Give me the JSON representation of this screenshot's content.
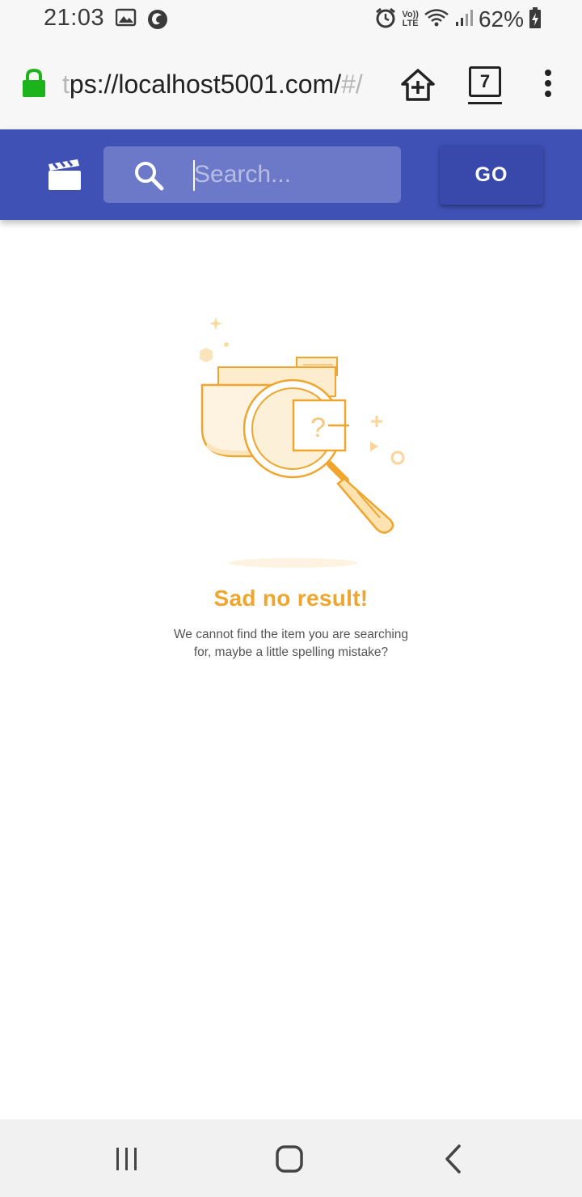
{
  "status_bar": {
    "time": "21:03",
    "battery": "62%",
    "volte_line1": "Vo))",
    "volte_line2": "LTE",
    "icons": [
      "image-icon",
      "firefox-icon",
      "alarm-icon",
      "volte-icon",
      "wifi-icon",
      "signal-icon",
      "battery-charging-icon"
    ]
  },
  "browser": {
    "url_faded": "t",
    "url_main": "ps://localhost5001.com/",
    "url_tail": "#/",
    "tab_count": "7",
    "icons": [
      "lock-icon",
      "home-plus-icon",
      "tabs-icon",
      "more-vert-icon"
    ]
  },
  "header": {
    "search_placeholder": "Search...",
    "search_value": "",
    "go_label": "GO",
    "accent_color": "#3f51b5",
    "search_box_color": "#6b79c8",
    "icons": [
      "clapperboard-icon",
      "search-icon"
    ]
  },
  "empty_state": {
    "title": "Sad no result!",
    "description_line1": "We cannot find the item you are searching",
    "description_line2": "for, maybe a little spelling mistake?",
    "title_color": "#f0a52c",
    "illustration": "folder-magnifier-illustration"
  },
  "nav_bar": {
    "icons": [
      "recent-apps-icon",
      "home-icon",
      "back-icon"
    ]
  }
}
